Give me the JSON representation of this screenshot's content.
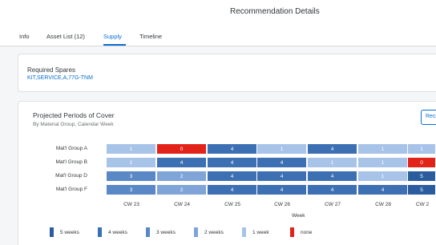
{
  "header": {
    "title": "Recommendation Details"
  },
  "tabs": [
    {
      "label": "Info"
    },
    {
      "label": "Asset List (12)"
    },
    {
      "label": "Supply",
      "selected": true
    },
    {
      "label": "Timeline"
    }
  ],
  "spares": {
    "title": "Required Spares",
    "value": "KIT,SERVICE,A,77G-TNM"
  },
  "cover": {
    "title": "Projected Periods of Cover",
    "subtitle": "By Material Group, Calendar Week",
    "button_label": "Reco"
  },
  "colors": {
    "5 weeks": "#2b5d9e",
    "4 weeks": "#3d6fb3",
    "3 weeks": "#5a87c6",
    "2 weeks": "#7fa4d8",
    "1 week": "#a7c3e8",
    "none": "#e2231a"
  },
  "chart_data": {
    "type": "heatmap",
    "title": "Projected Periods of Cover",
    "subtitle": "By Material Group, Calendar Week",
    "xlabel": "Week",
    "ylabel": "",
    "x": [
      "CW 23",
      "CW 24",
      "CW 25",
      "CW 26",
      "CW 27",
      "CW 28",
      "CW 2"
    ],
    "y": [
      "Mat'l Group A",
      "Mat'l Group B",
      "Mat'l Group D",
      "Mat'l Group F"
    ],
    "values": [
      [
        "1",
        "0",
        "4",
        "1",
        "4",
        "1",
        "1"
      ],
      [
        "1",
        "4",
        "4",
        "4",
        "1",
        "1",
        "0"
      ],
      [
        "3",
        "2",
        "4",
        "4",
        "4",
        "1",
        "5"
      ],
      [
        "3",
        "2",
        "4",
        "4",
        "4",
        "4",
        "5"
      ]
    ],
    "legend": [
      {
        "label": "5 weeks",
        "color": "#2b5d9e"
      },
      {
        "label": "4 weeks",
        "color": "#3d6fb3"
      },
      {
        "label": "3 weeks",
        "color": "#5a87c6"
      },
      {
        "label": "2 weeks",
        "color": "#7fa4d8"
      },
      {
        "label": "1 week",
        "color": "#a7c3e8"
      },
      {
        "label": "none",
        "color": "#e2231a"
      }
    ],
    "legend_position": "bottom"
  }
}
